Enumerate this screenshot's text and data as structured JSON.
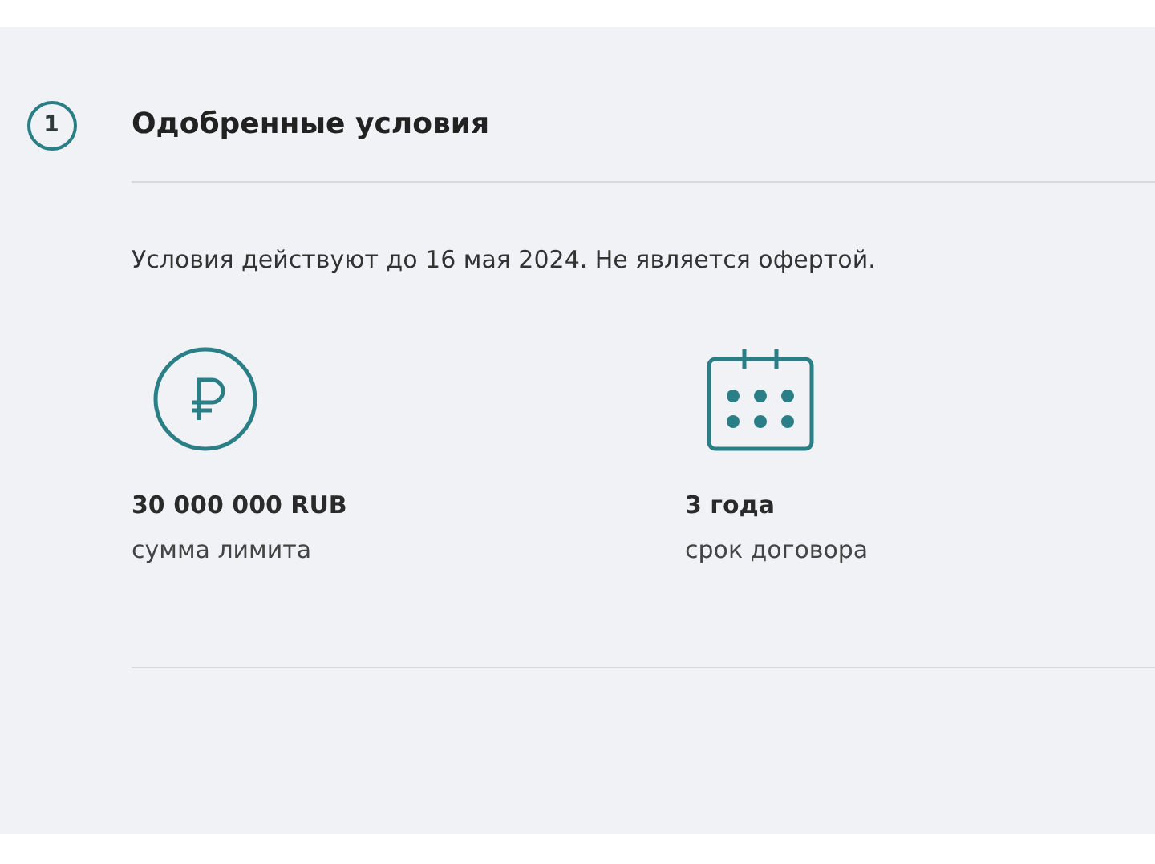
{
  "step": {
    "number": "1",
    "title": "Одобренные условия"
  },
  "note": "Условия действуют до 16 мая 2024. Не является офертой.",
  "terms": [
    {
      "kind": "ruble",
      "value": "30 000 000 RUB",
      "label": "сумма лимита"
    },
    {
      "kind": "calendar",
      "value": "3 года",
      "label": "срок договора"
    }
  ]
}
